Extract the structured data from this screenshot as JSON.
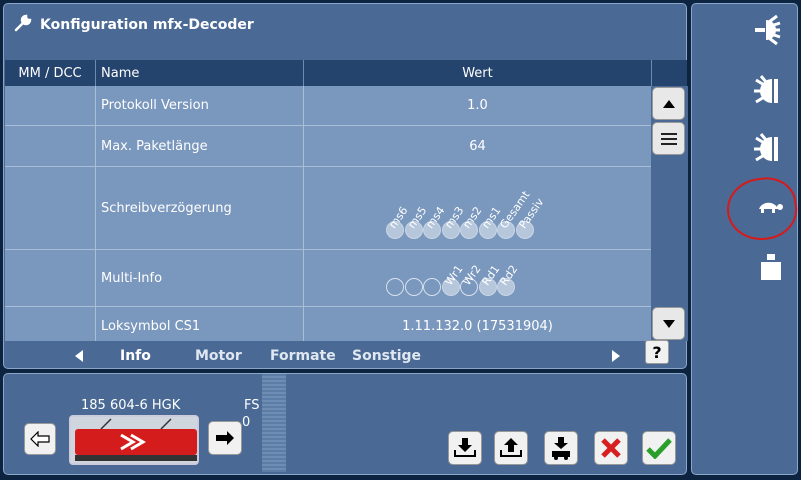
{
  "window": {
    "title": "Konfiguration mfx-Decoder"
  },
  "table": {
    "headers": [
      "MM / DCC",
      "Name",
      "Wert"
    ],
    "rows": [
      {
        "name": "Protokoll Version",
        "value": "1.0"
      },
      {
        "name": "Max. Paketlänge",
        "value": "64"
      },
      {
        "name": "Schreibverzögerung",
        "bits": [
          {
            "label": "ms6",
            "on": true
          },
          {
            "label": "ms5",
            "on": true
          },
          {
            "label": "ms4",
            "on": true
          },
          {
            "label": "ms3",
            "on": true
          },
          {
            "label": "ms2",
            "on": true
          },
          {
            "label": "ms1",
            "on": true
          },
          {
            "label": "Gesamt",
            "on": true
          },
          {
            "label": "Passiv",
            "on": true
          }
        ]
      },
      {
        "name": "Multi-Info",
        "bits": [
          {
            "label": "",
            "on": false
          },
          {
            "label": "",
            "on": false
          },
          {
            "label": "",
            "on": false
          },
          {
            "label": "Wr1",
            "on": true
          },
          {
            "label": "Wr2",
            "on": false
          },
          {
            "label": "Rd1",
            "on": true
          },
          {
            "label": "Rd2",
            "on": true
          }
        ]
      },
      {
        "name": "Loksymbol CS1",
        "value": "1.11.132.0 (17531904)"
      }
    ]
  },
  "tabs": {
    "items": [
      "Info",
      "Motor",
      "Formate",
      "Sonstige"
    ],
    "active": "Info",
    "help": "?"
  },
  "loco": {
    "name": "185 604-6 HGK",
    "fs_label": "FS",
    "fs_value": "0"
  },
  "icons": {
    "settings": "wrench-icon",
    "side": [
      "headlight-icon",
      "front-light-icon",
      "rear-light-icon",
      "turtle-icon",
      "weight-icon"
    ],
    "bottom": [
      "read-icon",
      "write-icon",
      "loco-read-icon",
      "cancel-icon",
      "confirm-icon"
    ]
  },
  "colors": {
    "panel": "#4a6a95",
    "header": "#24436d",
    "row": "#7a97bd",
    "cancel": "#d62020",
    "confirm": "#2aa02a",
    "annotation": "#d61a1a"
  }
}
